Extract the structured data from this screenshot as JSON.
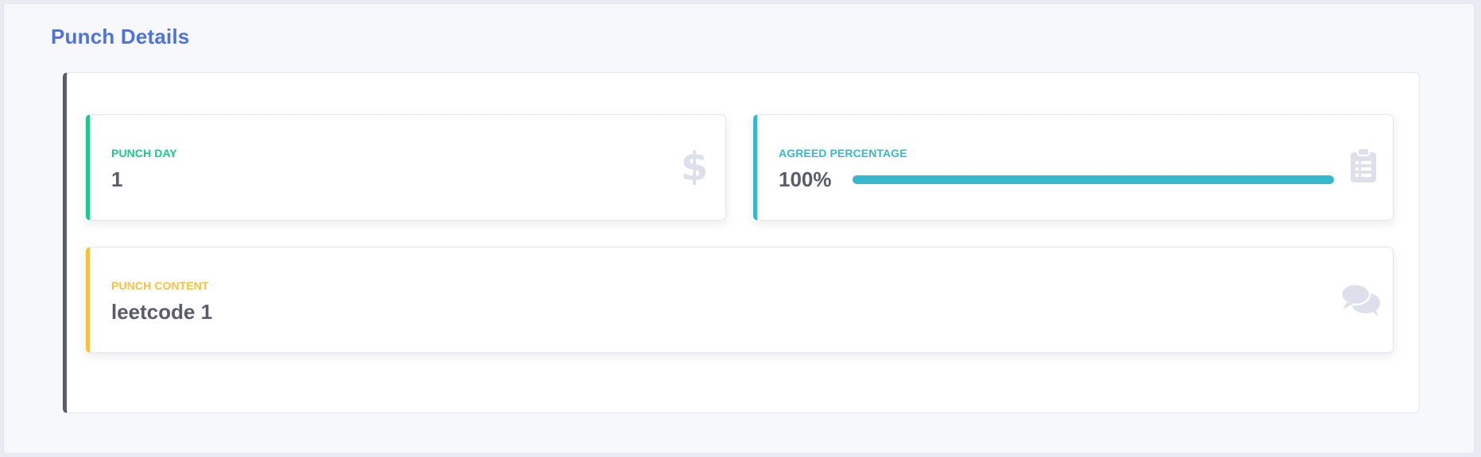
{
  "header": {
    "title": "Punch Details"
  },
  "cards": {
    "punch_day": {
      "label": "Punch Day",
      "value": "1",
      "icon": "dollar-icon"
    },
    "agreed_percentage": {
      "label": "Agreed Percentage",
      "value": "100%",
      "progress": 1.0,
      "icon": "clipboard-list-icon"
    },
    "punch_content": {
      "label": "Punch Content",
      "value": "leetcode 1",
      "icon": "comments-icon"
    }
  },
  "colors": {
    "title": "#4e73df",
    "success": "#1cc88a",
    "info": "#36b9cc",
    "warning": "#f6c23e",
    "text": "#5a5c69",
    "icon": "#dddfeb"
  }
}
